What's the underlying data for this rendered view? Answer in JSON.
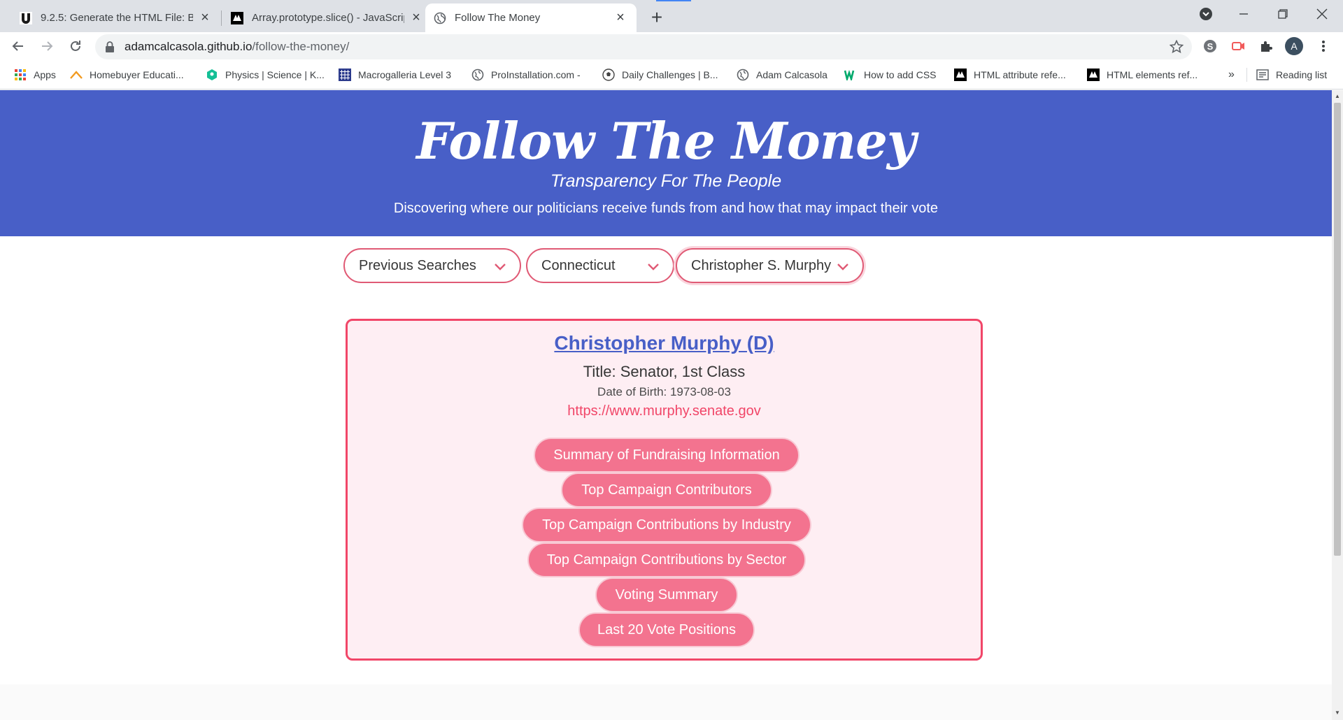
{
  "browser": {
    "tabs": [
      {
        "title": "9.2.5: Generate the HTML File: Bo",
        "icon": "u-logo-icon"
      },
      {
        "title": "Array.prototype.slice() - JavaScrip",
        "icon": "mdn-logo-icon"
      },
      {
        "title": "Follow The Money",
        "icon": "globe-icon",
        "active": true
      }
    ],
    "url_host": "adamcalcasola.github.io",
    "url_path": "/follow-the-money/",
    "profile_initial": "A",
    "bookmarks": [
      {
        "label": "Apps",
        "icon": "apps-grid-icon"
      },
      {
        "label": "Homebuyer Educati...",
        "icon": "roof-icon"
      },
      {
        "label": "Physics | Science | K...",
        "icon": "khan-academy-icon"
      },
      {
        "label": "Macrogalleria Level 3",
        "icon": "grid-logo-icon"
      },
      {
        "label": "ProInstallation.com -",
        "icon": "globe-icon"
      },
      {
        "label": "Daily Challenges | B...",
        "icon": "soccer-ball-icon"
      },
      {
        "label": "Adam Calcasola",
        "icon": "globe-icon"
      },
      {
        "label": "How to add CSS",
        "icon": "w3schools-icon"
      },
      {
        "label": "HTML attribute refe...",
        "icon": "mdn-logo-icon"
      },
      {
        "label": "HTML elements ref...",
        "icon": "mdn-logo-icon"
      }
    ],
    "more_bookmarks": "»",
    "reading_list": "Reading list"
  },
  "page": {
    "title": "Follow The Money",
    "subtitle": "Transparency For The People",
    "description": "Discovering where our politicians receive funds from and how that may impact their vote",
    "selects": {
      "previous": "Previous Searches",
      "state": "Connecticut",
      "politician": "Christopher S. Murphy"
    },
    "profile": {
      "name": "Christopher Murphy (D)",
      "title": "Title: Senator, 1st Class",
      "dob": "Date of Birth: 1973-08-03",
      "website": "https://www.murphy.senate.gov"
    },
    "actions": [
      "Summary of Fundraising Information",
      "Top Campaign Contributors",
      "Top Campaign Contributions by Industry",
      "Top Campaign Contributions by Sector",
      "Voting Summary",
      "Last 20 Vote Positions"
    ]
  },
  "colors": {
    "hero": "#485fc7",
    "accent": "#f14668",
    "pill": "#f3738f",
    "card_bg": "#feeef3"
  }
}
